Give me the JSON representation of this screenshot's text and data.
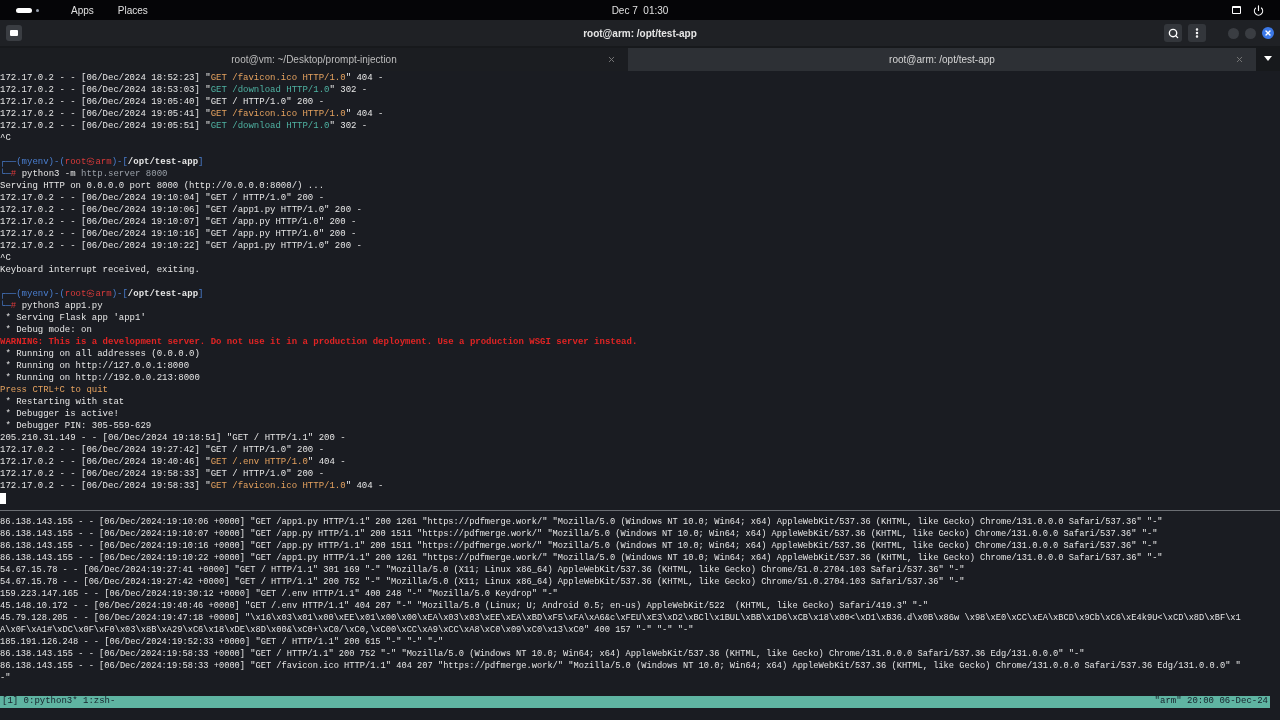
{
  "top_bar": {
    "menus": [
      "Apps",
      "Places"
    ],
    "clock": "Dec 7  01:30"
  },
  "window": {
    "title": "root@arm: /opt/test-app"
  },
  "tabs": [
    {
      "label": "root@vm: ~/Desktop/prompt-injection",
      "selected": false
    },
    {
      "label": "root@arm: /opt/test-app",
      "selected": true
    }
  ],
  "upper_pane": {
    "cursor_visible": true,
    "blocks": [
      [
        {
          "segments": [
            {
              "text": "172.17.0.2 - - [06/Dec/2024 18:52:23] \""
            },
            {
              "text": "GET /favicon.ico HTTP/1.0",
              "kind": "not_found"
            },
            {
              "text": "\" 404 -"
            }
          ]
        },
        {
          "segments": [
            {
              "text": "172.17.0.2 - - [06/Dec/2024 18:53:03] \""
            },
            {
              "text": "GET /download HTTP/1.0",
              "kind": "redirect"
            },
            {
              "text": "\" 302 -"
            }
          ]
        },
        {
          "segments": [
            {
              "text": "172.17.0.2 - - [06/Dec/2024 19:05:40] \"GET / HTTP/1.0\" 200 -"
            }
          ]
        },
        {
          "segments": [
            {
              "text": "172.17.0.2 - - [06/Dec/2024 19:05:41] \""
            },
            {
              "text": "GET /favicon.ico HTTP/1.0",
              "kind": "not_found"
            },
            {
              "text": "\" 404 -"
            }
          ]
        },
        {
          "segments": [
            {
              "text": "172.17.0.2 - - [06/Dec/2024 19:05:51] \""
            },
            {
              "text": "GET /download HTTP/1.0",
              "kind": "redirect"
            },
            {
              "text": "\" 302 -"
            }
          ]
        },
        {
          "segments": [
            {
              "text": "^C"
            }
          ]
        }
      ],
      [
        {
          "segments": [
            {
              "text": "┌──(myenv)-(",
              "kind": "frame"
            },
            {
              "text": "root㉿arm",
              "kind": "user"
            },
            {
              "text": ")-[",
              "kind": "frame"
            },
            {
              "text": "**/opt/test-app**"
            },
            {
              "text": "]",
              "kind": "frame"
            }
          ]
        },
        {
          "segments": [
            {
              "text": "└─",
              "kind": "frame"
            },
            {
              "text": "# ",
              "kind": "user"
            },
            {
              "text": "python3 -m "
            },
            {
              "text": "http.server 8000",
              "kind": "argument"
            }
          ]
        },
        {
          "segments": [
            {
              "text": "Serving HTTP on 0.0.0.0 port 8000 (http://0.0.0.0:8000/) ..."
            }
          ]
        },
        {
          "segments": [
            {
              "text": "172.17.0.2 - - [06/Dec/2024 19:10:04] \"GET / HTTP/1.0\" 200 -"
            }
          ]
        },
        {
          "segments": [
            {
              "text": "172.17.0.2 - - [06/Dec/2024 19:10:06] \"GET /app1.py HTTP/1.0\" 200 -"
            }
          ]
        },
        {
          "segments": [
            {
              "text": "172.17.0.2 - - [06/Dec/2024 19:10:07] \"GET /app.py HTTP/1.0\" 200 -"
            }
          ]
        },
        {
          "segments": [
            {
              "text": "172.17.0.2 - - [06/Dec/2024 19:10:16] \"GET /app.py HTTP/1.0\" 200 -"
            }
          ]
        },
        {
          "segments": [
            {
              "text": "172.17.0.2 - - [06/Dec/2024 19:10:22] \"GET /app1.py HTTP/1.0\" 200 -"
            }
          ]
        },
        {
          "segments": [
            {
              "text": "^C"
            }
          ]
        },
        {
          "segments": [
            {
              "text": "Keyboard interrupt received, exiting."
            }
          ]
        }
      ],
      [
        {
          "segments": [
            {
              "text": "┌──(myenv)-(",
              "kind": "frame"
            },
            {
              "text": "root㉿arm",
              "kind": "user"
            },
            {
              "text": ")-[",
              "kind": "frame"
            },
            {
              "text": "**/opt/test-app**"
            },
            {
              "text": "]",
              "kind": "frame"
            }
          ]
        },
        {
          "segments": [
            {
              "text": "└─",
              "kind": "frame"
            },
            {
              "text": "# ",
              "kind": "user"
            },
            {
              "text": "python3 app1.py"
            }
          ]
        },
        {
          "segments": [
            {
              "text": " * Serving Flask app 'app1'"
            }
          ]
        },
        {
          "segments": [
            {
              "text": " * Debug mode: on"
            }
          ]
        },
        {
          "segments": [
            {
              "text": "WARNING: This is a development server. Do not use it in a production deployment. Use a production WSGI server instead.",
              "kind": "warning"
            }
          ]
        },
        {
          "segments": [
            {
              "text": " * Running on all addresses (0.0.0.0)"
            }
          ]
        },
        {
          "segments": [
            {
              "text": " * Running on http://127.0.0.1:8000"
            }
          ]
        },
        {
          "segments": [
            {
              "text": " * Running on http://192.0.0.213:8000"
            }
          ]
        },
        {
          "segments": [
            {
              "text": "Press CTRL+C to quit",
              "kind": "not_found"
            }
          ]
        },
        {
          "segments": [
            {
              "text": " * Restarting with stat"
            }
          ]
        },
        {
          "segments": [
            {
              "text": " * Debugger is active!"
            }
          ]
        },
        {
          "segments": [
            {
              "text": " * Debugger PIN: 305-559-629"
            }
          ]
        },
        {
          "segments": [
            {
              "text": "205.210.31.149 - - [06/Dec/2024 19:18:51] \"GET / HTTP/1.1\" 200 -"
            }
          ]
        },
        {
          "segments": [
            {
              "text": "172.17.0.2 - - [06/Dec/2024 19:27:42] \"GET / HTTP/1.0\" 200 -"
            }
          ]
        },
        {
          "segments": [
            {
              "text": "172.17.0.2 - - [06/Dec/2024 19:40:46] \""
            },
            {
              "text": "GET /.env HTTP/1.0",
              "kind": "not_found"
            },
            {
              "text": "\" 404 -"
            }
          ]
        },
        {
          "segments": [
            {
              "text": "172.17.0.2 - - [06/Dec/2024 19:58:33] \"GET / HTTP/1.0\" 200 -"
            }
          ]
        },
        {
          "segments": [
            {
              "text": "172.17.0.2 - - [06/Dec/2024 19:58:33] \""
            },
            {
              "text": "GET /favicon.ico HTTP/1.0",
              "kind": "not_found"
            },
            {
              "text": "\" 404 -"
            }
          ]
        }
      ]
    ]
  },
  "lower_pane": {
    "lines": [
      "86.138.143.155 - - [06/Dec/2024:19:10:06 +0000] \"GET /app1.py HTTP/1.1\" 200 1261 \"https://pdfmerge.work/\" \"Mozilla/5.0 (Windows NT 10.0; Win64; x64) AppleWebKit/537.36 (KHTML, like Gecko) Chrome/131.0.0.0 Safari/537.36\" \"-\"",
      "86.138.143.155 - - [06/Dec/2024:19:10:07 +0000] \"GET /app.py HTTP/1.1\" 200 1511 \"https://pdfmerge.work/\" \"Mozilla/5.0 (Windows NT 10.0; Win64; x64) AppleWebKit/537.36 (KHTML, like Gecko) Chrome/131.0.0.0 Safari/537.36\" \"-\"",
      "86.138.143.155 - - [06/Dec/2024:19:10:16 +0000] \"GET /app.py HTTP/1.1\" 200 1511 \"https://pdfmerge.work/\" \"Mozilla/5.0 (Windows NT 10.0; Win64; x64) AppleWebKit/537.36 (KHTML, like Gecko) Chrome/131.0.0.0 Safari/537.36\" \"-\"",
      "86.138.143.155 - - [06/Dec/2024:19:10:22 +0000] \"GET /app1.py HTTP/1.1\" 200 1261 \"https://pdfmerge.work/\" \"Mozilla/5.0 (Windows NT 10.0; Win64; x64) AppleWebKit/537.36 (KHTML, like Gecko) Chrome/131.0.0.0 Safari/537.36\" \"-\"",
      "54.67.15.78 - - [06/Dec/2024:19:27:41 +0000] \"GET / HTTP/1.1\" 301 169 \"-\" \"Mozilla/5.0 (X11; Linux x86_64) AppleWebKit/537.36 (KHTML, like Gecko) Chrome/51.0.2704.103 Safari/537.36\" \"-\"",
      "54.67.15.78 - - [06/Dec/2024:19:27:42 +0000] \"GET / HTTP/1.1\" 200 752 \"-\" \"Mozilla/5.0 (X11; Linux x86_64) AppleWebKit/537.36 (KHTML, like Gecko) Chrome/51.0.2704.103 Safari/537.36\" \"-\"",
      "159.223.147.165 - - [06/Dec/2024:19:30:12 +0000] \"GET /.env HTTP/1.1\" 400 248 \"-\" \"Mozilla/5.0 Keydrop\" \"-\"",
      "45.148.10.172 - - [06/Dec/2024:19:40:46 +0000] \"GET /.env HTTP/1.1\" 404 207 \"-\" \"Mozilla/5.0 (Linux; U; Android 0.5; en-us) AppleWebKit/522  (KHTML, like Gecko) Safari/419.3\" \"-\"",
      "45.79.128.205 - - [06/Dec/2024:19:47:18 +0000] \"\\x16\\x03\\x01\\x00\\xEE\\x01\\x00\\x00\\xEA\\x03\\x03\\xEE\\xEA\\xBD\\xF5\\xFA\\xA6&c\\xFEU\\xE3\\xD2\\xBCl\\x1BUL\\xBB\\x1D6\\xCB\\x18\\x00<\\xD1\\xB36.d\\x0B\\x86w \\x98\\xE0\\xCC\\xEA\\xBCD\\x9Cb\\xC6\\xE4k9U<\\xCD\\x8D\\xBF\\x1",
      "A\\x0F\\xA1#\\xDC\\x0F\\xF0\\x03\\x8B\\xA29\\xC6\\x18\\xDE\\x8D\\x00&\\xC0+\\xC0/\\xC0,\\xC00\\xCC\\xA9\\xCC\\xA8\\xC0\\x09\\xC0\\x13\\xC0\" 400 157 \"-\" \"-\" \"-\"",
      "185.191.126.248 - - [06/Dec/2024:19:52:33 +0000] \"GET / HTTP/1.1\" 200 615 \"-\" \"-\" \"-\"",
      "86.138.143.155 - - [06/Dec/2024:19:58:33 +0000] \"GET / HTTP/1.1\" 200 752 \"-\" \"Mozilla/5.0 (Windows NT 10.0; Win64; x64) AppleWebKit/537.36 (KHTML, like Gecko) Chrome/131.0.0.0 Safari/537.36 Edg/131.0.0.0\" \"-\"",
      "86.138.143.155 - - [06/Dec/2024:19:58:33 +0000] \"GET /favicon.ico HTTP/1.1\" 404 207 \"https://pdfmerge.work/\" \"Mozilla/5.0 (Windows NT 10.0; Win64; x64) AppleWebKit/537.36 (KHTML, like Gecko) Chrome/131.0.0.0 Safari/537.36 Edg/131.0.0.0\" \"",
      "-\""
    ]
  },
  "status_bar": {
    "windows": "[1] 0:python3* 1:zsh-",
    "info": "\"arm\" 20:00 06-Dec-24"
  }
}
